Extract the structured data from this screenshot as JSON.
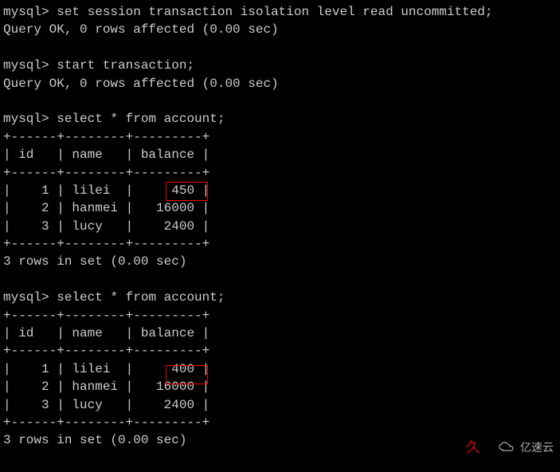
{
  "prompt": "mysql>",
  "commands": {
    "cmd1": "set session transaction isolation level read uncommitted;",
    "cmd2": "start transaction;",
    "cmd3": "select * from account;",
    "cmd4": "select * from account;"
  },
  "responses": {
    "query_ok": "Query OK, 0 rows affected (0.00 sec)",
    "rows_in_set": "3 rows in set (0.00 sec)"
  },
  "table1": {
    "separator": "+------+--------+---------+",
    "header": "| id   | name   | balance |",
    "rows": [
      "|    1 | lilei  |     450 |",
      "|    2 | hanmei |   16000 |",
      "|    3 | lucy   |    2400 |"
    ]
  },
  "table2": {
    "separator": "+------+--------+---------+",
    "header": "| id   | name   | balance |",
    "rows": [
      "|    1 | lilei  |     400 |",
      "|    2 | hanmei |   16000 |",
      "|    3 | lucy   |    2400 |"
    ]
  },
  "watermark": {
    "text": "亿速云"
  },
  "highlights": {
    "box1_value": "450",
    "box2_value": "400"
  },
  "chart_data": {
    "type": "table",
    "title": "account",
    "columns": [
      "id",
      "name",
      "balance"
    ],
    "query1_rows": [
      {
        "id": 1,
        "name": "lilei",
        "balance": 450
      },
      {
        "id": 2,
        "name": "hanmei",
        "balance": 16000
      },
      {
        "id": 3,
        "name": "lucy",
        "balance": 2400
      }
    ],
    "query2_rows": [
      {
        "id": 1,
        "name": "lilei",
        "balance": 400
      },
      {
        "id": 2,
        "name": "hanmei",
        "balance": 16000
      },
      {
        "id": 3,
        "name": "lucy",
        "balance": 2400
      }
    ]
  }
}
